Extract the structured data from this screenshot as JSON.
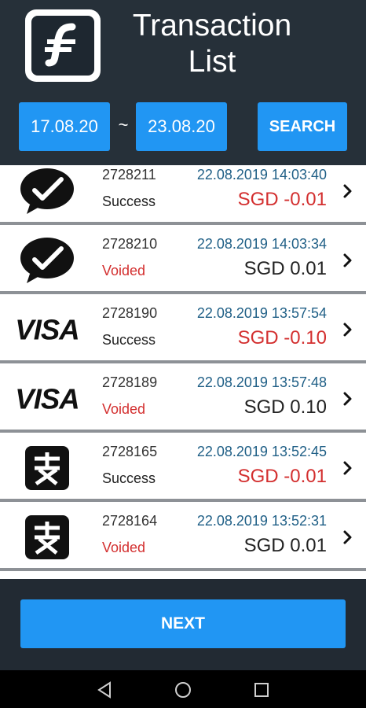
{
  "header": {
    "title_line1": "Transaction",
    "title_line2": "List",
    "logo_icon": "brand-f-logo-icon"
  },
  "filter": {
    "date_from": "17.08.20",
    "separator": "~",
    "date_to": "23.08.20",
    "search_label": "SEARCH"
  },
  "transactions": [
    {
      "icon": "wechat-pay-icon",
      "id": "2728211",
      "status": "Success",
      "datetime": "22.08.2019 14:03:40",
      "amount": "SGD -0.01"
    },
    {
      "icon": "wechat-pay-icon",
      "id": "2728210",
      "status": "Voided",
      "datetime": "22.08.2019 14:03:34",
      "amount": "SGD 0.01"
    },
    {
      "icon": "visa-icon",
      "id": "2728190",
      "status": "Success",
      "datetime": "22.08.2019 13:57:54",
      "amount": "SGD -0.10"
    },
    {
      "icon": "visa-icon",
      "id": "2728189",
      "status": "Voided",
      "datetime": "22.08.2019 13:57:48",
      "amount": "SGD 0.10"
    },
    {
      "icon": "alipay-icon",
      "id": "2728165",
      "status": "Success",
      "datetime": "22.08.2019 13:52:45",
      "amount": "SGD -0.01"
    },
    {
      "icon": "alipay-icon",
      "id": "2728164",
      "status": "Voided",
      "datetime": "22.08.2019 13:52:31",
      "amount": "SGD 0.01"
    }
  ],
  "footer": {
    "next_label": "NEXT"
  },
  "colors": {
    "accent": "#2196f3",
    "background": "#222a33",
    "negative": "#d32f2f",
    "datetime": "#1f5f86"
  }
}
